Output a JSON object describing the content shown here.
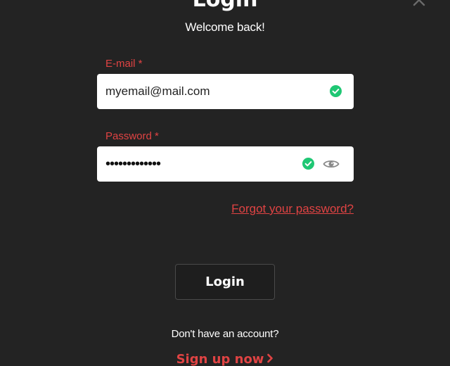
{
  "dialog": {
    "title": "Login",
    "subtitle": "Welcome back!"
  },
  "form": {
    "email": {
      "label": "E-mail *",
      "value": "myemail@mail.com",
      "valid": true,
      "icon": "check-circle-icon"
    },
    "password": {
      "label": "Password *",
      "value": "•••••••••••••",
      "valid": true,
      "icon": "check-circle-icon",
      "toggle_icon": "eye-icon"
    },
    "forgot_link": "Forgot your password?",
    "submit_label": "Login"
  },
  "footer": {
    "account_prompt": "Don't have an account?",
    "signup_link": "Sign up now",
    "signup_icon": "chevron-right-icon"
  },
  "colors": {
    "background": "#232323",
    "accent": "#e04343",
    "valid": "#1fc774",
    "field_bg": "#ffffff"
  }
}
